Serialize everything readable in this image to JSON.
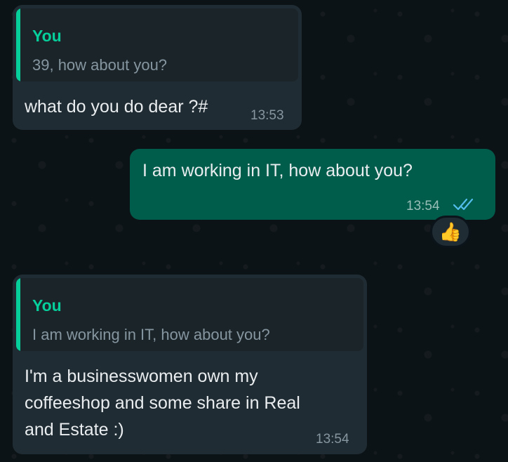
{
  "messages": [
    {
      "direction": "incoming",
      "quote": {
        "author": "You",
        "text": "39, how about you?"
      },
      "text": "what do you do dear ?#",
      "time": "13:53"
    },
    {
      "direction": "outgoing",
      "text": "I am working in IT, how about you?",
      "time": "13:54",
      "status": "read",
      "reaction": "👍"
    },
    {
      "direction": "incoming",
      "quote": {
        "author": "You",
        "text": "I am working in IT, how about you?"
      },
      "text_lines": [
        "I'm a businesswomen own my",
        "coffeeshop and some share in Real",
        "and Estate :)"
      ],
      "time": "13:54"
    }
  ],
  "icons": {
    "read_receipt": "double-check-icon",
    "reaction": "thumbs-up-icon"
  },
  "colors": {
    "background": "#0b141a",
    "incoming_bubble": "#202c33",
    "outgoing_bubble": "#005c4b",
    "quote_accent": "#06cf9c",
    "read_tick": "#53bdeb"
  }
}
